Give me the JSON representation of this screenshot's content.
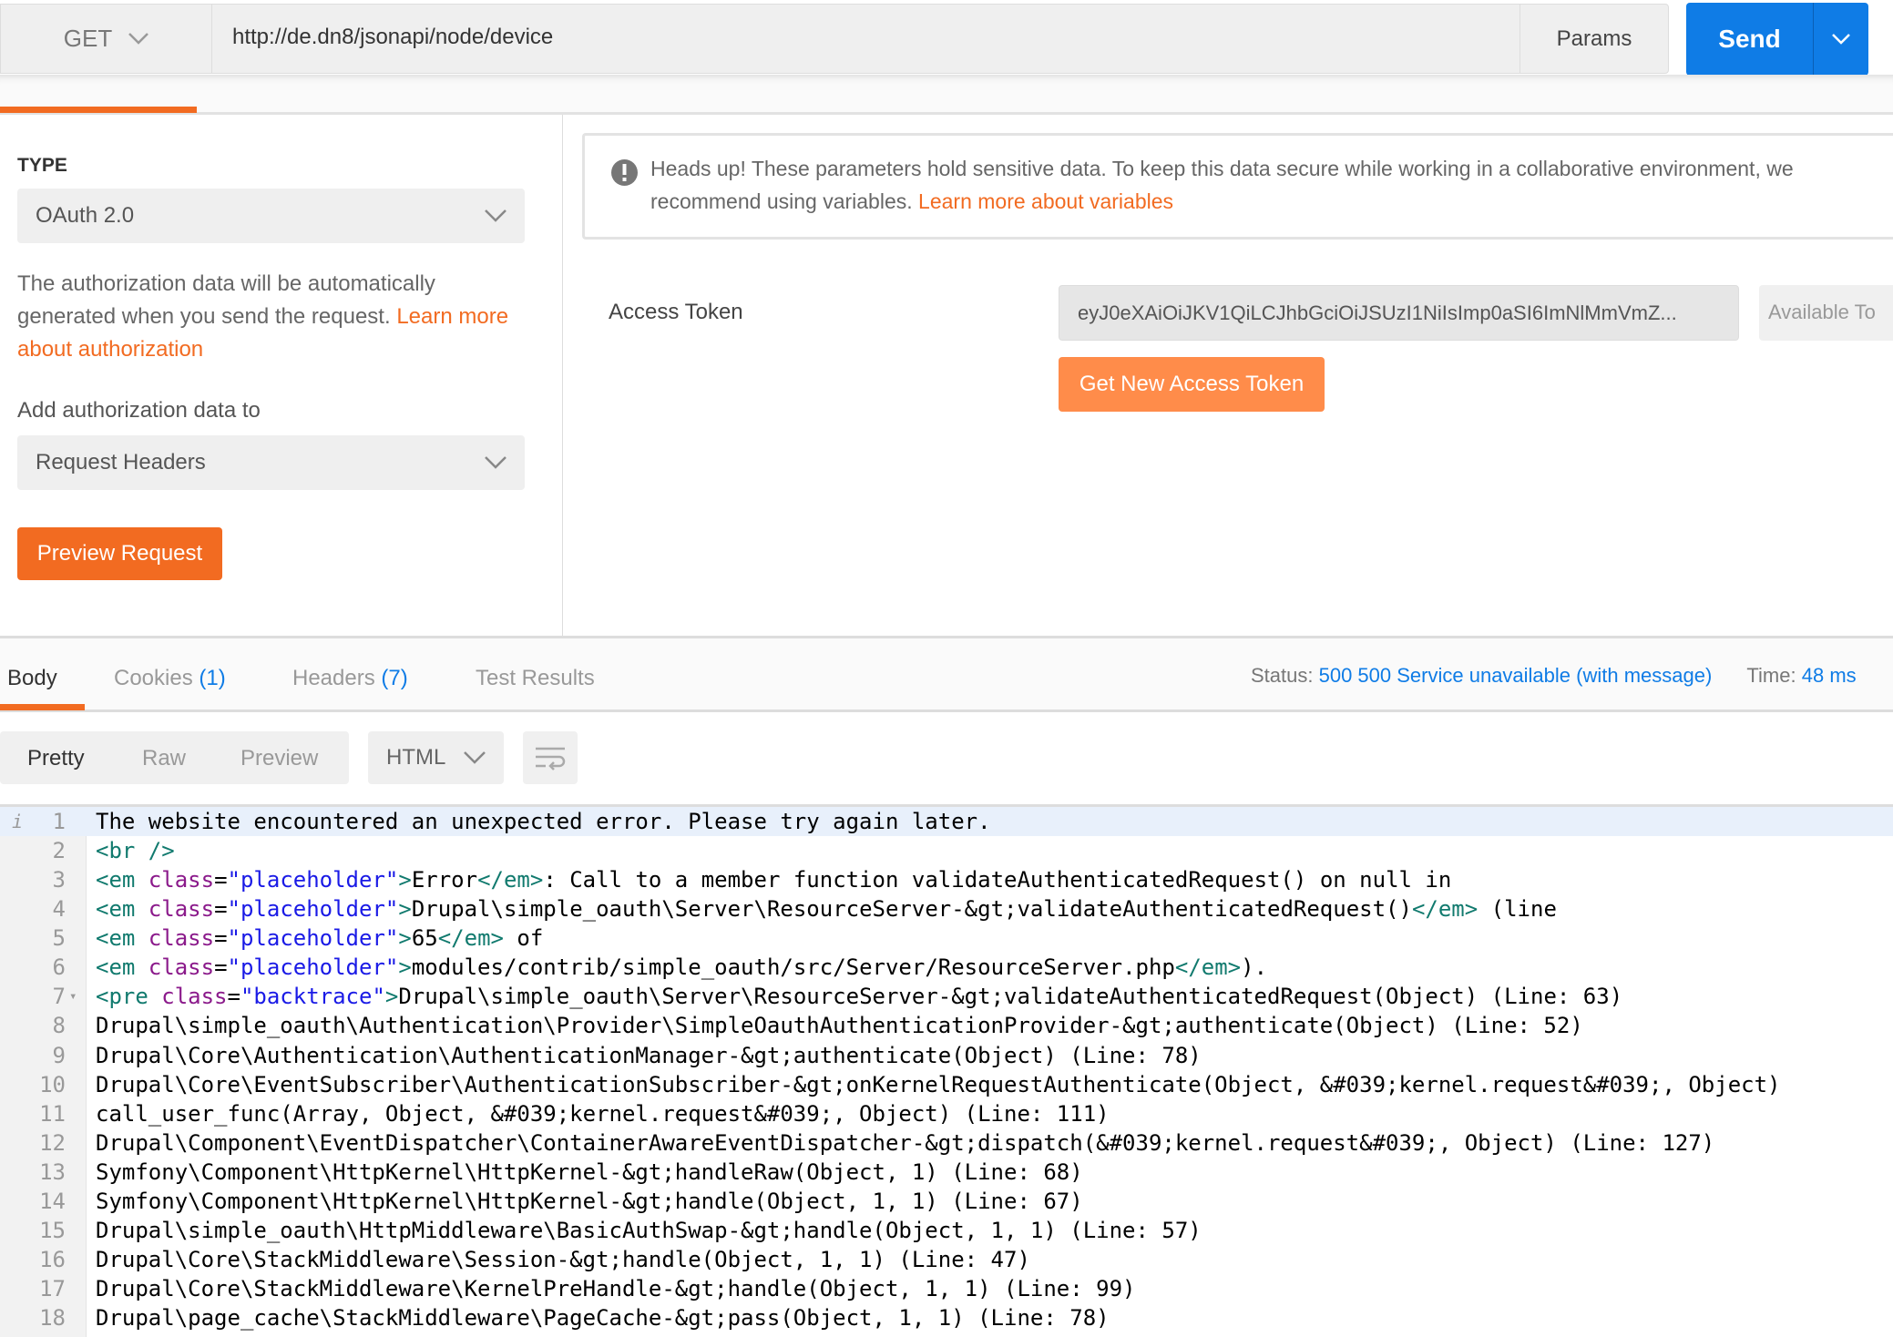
{
  "request": {
    "method": "GET",
    "url": "http://de.dn8/jsonapi/node/device",
    "params_label": "Params",
    "send_label": "Send"
  },
  "auth": {
    "type_label": "TYPE",
    "type_value": "OAuth 2.0",
    "description": "The authorization data will be automatically generated when you send the request.",
    "description_link": "Learn more about authorization",
    "add_to_label": "Add authorization data to",
    "add_to_value": "Request Headers",
    "preview_button": "Preview Request",
    "notice_text": "Heads up! These parameters hold sensitive data. To keep this data secure while working in a collaborative environment, we",
    "notice_text2": "recommend using variables.",
    "notice_link": "Learn more about variables",
    "access_token_label": "Access Token",
    "access_token_value": "eyJ0eXAiOiJKV1QiLCJhbGciOiJSUzI1NiIsImp0aSI6ImNlMmVmZ...",
    "available_tokens": "Available To",
    "get_token_button": "Get New Access Token"
  },
  "response": {
    "tabs": [
      {
        "label": "Body"
      },
      {
        "label": "Cookies",
        "count": "(1)"
      },
      {
        "label": "Headers",
        "count": "(7)"
      },
      {
        "label": "Test Results"
      }
    ],
    "status_label": "Status:",
    "status_value": "500 500 Service unavailable (with message)",
    "time_label": "Time:",
    "time_value": "48 ms",
    "view_modes": [
      "Pretty",
      "Raw",
      "Preview"
    ],
    "format": "HTML",
    "lines": [
      "The website encountered an unexpected error. Please try again later.",
      "<br />",
      "<em class=\"placeholder\">Error</em>: Call to a member function validateAuthenticatedRequest() on null in",
      "<em class=\"placeholder\">Drupal\\simple_oauth\\Server\\ResourceServer-&gt;validateAuthenticatedRequest()</em> (line",
      "<em class=\"placeholder\">65</em> of",
      "<em class=\"placeholder\">modules/contrib/simple_oauth/src/Server/ResourceServer.php</em>).",
      "<pre class=\"backtrace\">Drupal\\simple_oauth\\Server\\ResourceServer-&gt;validateAuthenticatedRequest(Object) (Line: 63)",
      "Drupal\\simple_oauth\\Authentication\\Provider\\SimpleOauthAuthenticationProvider-&gt;authenticate(Object) (Line: 52)",
      "Drupal\\Core\\Authentication\\AuthenticationManager-&gt;authenticate(Object) (Line: 78)",
      "Drupal\\Core\\EventSubscriber\\AuthenticationSubscriber-&gt;onKernelRequestAuthenticate(Object, &#039;kernel.request&#039;, Object)",
      "call_user_func(Array, Object, &#039;kernel.request&#039;, Object) (Line: 111)",
      "Drupal\\Component\\EventDispatcher\\ContainerAwareEventDispatcher-&gt;dispatch(&#039;kernel.request&#039;, Object) (Line: 127)",
      "Symfony\\Component\\HttpKernel\\HttpKernel-&gt;handleRaw(Object, 1) (Line: 68)",
      "Symfony\\Component\\HttpKernel\\HttpKernel-&gt;handle(Object, 1, 1) (Line: 67)",
      "Drupal\\simple_oauth\\HttpMiddleware\\BasicAuthSwap-&gt;handle(Object, 1, 1) (Line: 57)",
      "Drupal\\Core\\StackMiddleware\\Session-&gt;handle(Object, 1, 1) (Line: 47)",
      "Drupal\\Core\\StackMiddleware\\KernelPreHandle-&gt;handle(Object, 1, 1) (Line: 99)",
      "Drupal\\page_cache\\StackMiddleware\\PageCache-&gt;pass(Object, 1, 1) (Line: 78)"
    ]
  },
  "colors": {
    "accent": "#f26b21",
    "send": "#0f7ce6",
    "status": "#0f7ce6"
  }
}
